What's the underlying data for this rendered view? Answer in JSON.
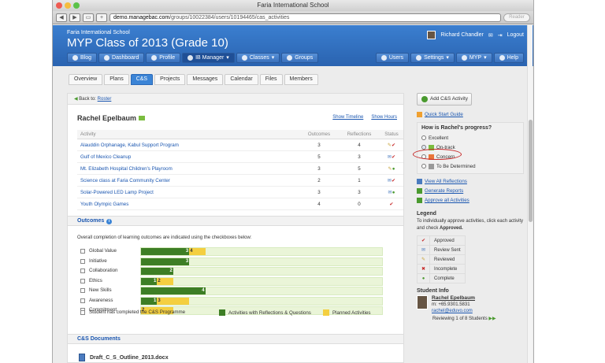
{
  "window": {
    "title": "Faria International School"
  },
  "browser": {
    "url_host": "demo.managebac.com",
    "url_path": "/groups/10022384/users/10194465/cas_activities",
    "reader_label": "Reader"
  },
  "header": {
    "school": "Faria International School",
    "class_title": "MYP Class of 2013 (Grade 10)",
    "user_name": "Richard Chandler",
    "logout_label": "Logout",
    "nav": [
      "Blog",
      "Dashboard",
      "Profile",
      "IB Manager",
      "Classes",
      "Groups"
    ],
    "nav_right": [
      "Users",
      "Settings",
      "MYP",
      "Help"
    ]
  },
  "tabs": [
    "Overview",
    "Plans",
    "C&S",
    "Projects",
    "Messages",
    "Calendar",
    "Files",
    "Members"
  ],
  "back": {
    "prefix": "Back to:",
    "link": "Roster"
  },
  "student": {
    "name": "Rachel Epelbaum"
  },
  "links": {
    "show_timeline": "Show Timeline",
    "show_hours": "Show Hours"
  },
  "activities": {
    "headers": [
      "Activity",
      "Outcomes",
      "Reflections",
      "Status"
    ],
    "rows": [
      {
        "name": "Alauddin Orphanage, Kabul Support Program",
        "outcomes": "3",
        "reflections": "4"
      },
      {
        "name": "Gulf of Mexico Cleanup",
        "outcomes": "5",
        "reflections": "3"
      },
      {
        "name": "Mt. Elizabeth Hospital Children's Playroom",
        "outcomes": "3",
        "reflections": "5"
      },
      {
        "name": "Science class at Faria Community Center",
        "outcomes": "2",
        "reflections": "1"
      },
      {
        "name": "Solar-Powered LED Lamp Project",
        "outcomes": "3",
        "reflections": "3"
      },
      {
        "name": "Youth Olympic Games",
        "outcomes": "4",
        "reflections": "0"
      }
    ]
  },
  "outcomes": {
    "title": "Outcomes",
    "intro": "Overall completion of learning outcomes are indicated using the checkboxes below:",
    "rows": [
      {
        "label": "Global Value",
        "green": 3,
        "yellow": 4
      },
      {
        "label": "Initiative",
        "green": 3,
        "yellow": 3
      },
      {
        "label": "Collaboration",
        "green": 2,
        "yellow": 2
      },
      {
        "label": "Ethics",
        "green": 1,
        "yellow": 2
      },
      {
        "label": "New Skills",
        "green": 4,
        "yellow": 4
      },
      {
        "label": "Awareness",
        "green": 1,
        "yellow": 3
      },
      {
        "label": "Commitment",
        "green": 0,
        "yellow": 2
      }
    ],
    "scale_max": 15,
    "completed_label": "Student has completed the C&S Programme",
    "legend_green": "Activities with Reflections & Questions",
    "legend_yellow": "Planned Activities",
    "green_color": "#3d7e25",
    "yellow_color": "#f4cf40"
  },
  "documents": {
    "title": "C&S Documents",
    "file": "Draft_C_S_Outline_2013.docx"
  },
  "sidebar": {
    "add_button": "Add C&S Activity",
    "quick_start": "Quick Start Guide",
    "progress_title": "How is Rachel's progress?",
    "progress_options": [
      "Excellent",
      "On-track",
      "Concern",
      "To Be Determined"
    ],
    "progress_selected": "On-track",
    "view_reflections": "View All Reflections",
    "generate_reports": "Generate Reports",
    "approve_all": "Approve all Activities",
    "legend_title": "Legend",
    "legend_desc_1": "To individually approve activities, click each activity and check",
    "legend_desc_bold": "Approved.",
    "legend_items": [
      "Approved",
      "Review Sent",
      "Reviewed",
      "Incomplete",
      "Complete"
    ],
    "student_info_title": "Student Info",
    "student_name": "Rachel Epelbaum",
    "student_phone": "m: +65.9301.5831",
    "student_email": "rachel@eduvo.com",
    "reviewing": "Reviewing 1 of 8 Students"
  }
}
